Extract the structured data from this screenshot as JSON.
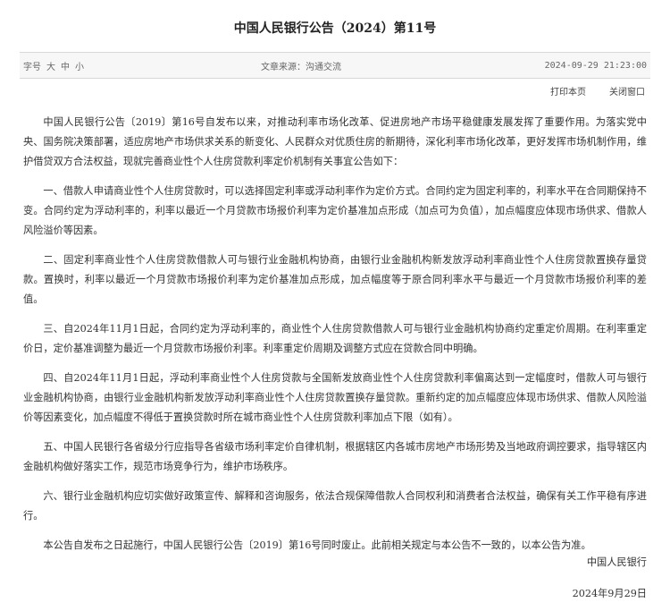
{
  "header": {
    "title": "中国人民银行公告（2024）第11号"
  },
  "meta": {
    "font_label": "字号",
    "font_sizes": [
      "大",
      "中",
      "小"
    ],
    "source": "文章来源：沟通交流",
    "datetime": "2024-09-29 21:23:00"
  },
  "actions": {
    "print": "打印本页",
    "close": "关闭窗口"
  },
  "paragraphs": [
    "中国人民银行公告〔2019〕第16号自发布以来，对推动利率市场化改革、促进房地产市场平稳健康发展发挥了重要作用。为落实党中央、国务院决策部署，适应房地产市场供求关系的新变化、人民群众对优质住房的新期待，深化利率市场化改革，更好发挥市场机制作用，维护借贷双方合法权益，现就完善商业性个人住房贷款利率定价机制有关事宜公告如下：",
    "一、借款人申请商业性个人住房贷款时，可以选择固定利率或浮动利率作为定价方式。合同约定为固定利率的，利率水平在合同期保持不变。合同约定为浮动利率的，利率以最近一个月贷款市场报价利率为定价基准加点形成（加点可为负值），加点幅度应体现市场供求、借款人风险溢价等因素。",
    "二、固定利率商业性个人住房贷款借款人可与银行业金融机构协商，由银行业金融机构新发放浮动利率商业性个人住房贷款置换存量贷款。置换时，利率以最近一个月贷款市场报价利率为定价基准加点形成，加点幅度等于原合同利率水平与最近一个月贷款市场报价利率的差值。",
    "三、自2024年11月1日起，合同约定为浮动利率的，商业性个人住房贷款借款人可与银行业金融机构协商约定重定价周期。在利率重定价日，定价基准调整为最近一个月贷款市场报价利率。利率重定价周期及调整方式应在贷款合同中明确。",
    "四、自2024年11月1日起，浮动利率商业性个人住房贷款与全国新发放商业性个人住房贷款利率偏离达到一定幅度时，借款人可与银行业金融机构协商，由银行业金融机构新发放浮动利率商业性个人住房贷款置换存量贷款。重新约定的加点幅度应体现市场供求、借款人风险溢价等因素变化，加点幅度不得低于置换贷款时所在城市商业性个人住房贷款利率加点下限（如有）。",
    "五、中国人民银行各省级分行应指导各省级市场利率定价自律机制，根据辖区内各城市房地产市场形势及当地政府调控要求，指导辖区内金融机构做好落实工作，规范市场竞争行为，维护市场秩序。",
    "六、银行业金融机构应切实做好政策宣传、解释和咨询服务，依法合规保障借款人合同权利和消费者合法权益，确保有关工作平稳有序进行。",
    "本公告自发布之日起施行，中国人民银行公告〔2019〕第16号同时废止。此前相关规定与本公告不一致的，以本公告为准。"
  ],
  "signature": {
    "org": "中国人民银行",
    "date": "2024年9月29日"
  }
}
